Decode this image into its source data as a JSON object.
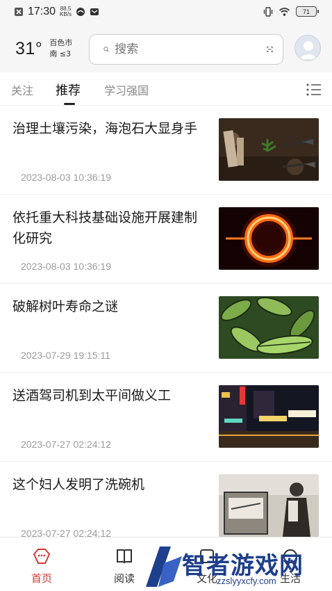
{
  "status_bar": {
    "time": "17:30",
    "net_speed_value": "88.5",
    "net_speed_unit": "KB/s",
    "battery": "71"
  },
  "header": {
    "temperature": "31°",
    "city": "百色市",
    "wind": "南 ≤3",
    "search_placeholder": "搜索"
  },
  "tabs": [
    {
      "label": "关注"
    },
    {
      "label": "推荐"
    },
    {
      "label": "学习强国"
    }
  ],
  "feed": [
    {
      "title": "治理土壤污染，海泡石大显身手",
      "time": "2023-08-03 10:36:19",
      "thumb": "soil-plants"
    },
    {
      "title": "依托重大科技基础设施开展建制化研究",
      "time": "2023-08-03 10:36:19",
      "thumb": "fire-ring"
    },
    {
      "title": "破解树叶寿命之谜",
      "time": "2023-07-29 19:15:11",
      "thumb": "green-leaves"
    },
    {
      "title": "送酒驾司机到太平间做义工",
      "time": "2023-07-27 02:24:12",
      "thumb": "night-street"
    },
    {
      "title": "这个妇人发明了洗碗机",
      "time": "2023-07-27 02:24:12",
      "thumb": "vintage-photo"
    }
  ],
  "bottom_nav": [
    {
      "label": "首页",
      "icon": "home-icon"
    },
    {
      "label": "阅读",
      "icon": "book-icon"
    },
    {
      "label": "文化",
      "icon": "culture-icon"
    },
    {
      "label": "生活",
      "icon": "life-icon"
    }
  ],
  "watermark": {
    "text": "智者游戏网",
    "url": "zzslyyxcfy.com"
  },
  "colors": {
    "accent": "#d03a3a",
    "watermark": "#1e3f8c"
  }
}
